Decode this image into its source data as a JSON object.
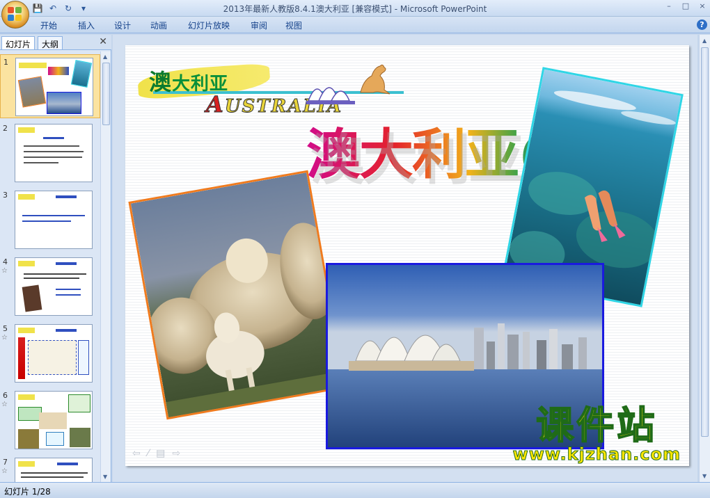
{
  "window": {
    "title": "2013年最新人教版8.4.1澳大利亚 [兼容模式] - Microsoft PowerPoint",
    "controls": [
      "–",
      "□",
      "×"
    ]
  },
  "qat": {
    "save": "💾",
    "undo": "↶",
    "redo": "↻",
    "customize": "▾"
  },
  "ribbon": {
    "tabs": [
      "开始",
      "插入",
      "设计",
      "动画",
      "幻灯片放映",
      "审阅",
      "视图"
    ],
    "help": "?"
  },
  "panel": {
    "tabs": [
      "幻灯片",
      "大纲"
    ],
    "close": "✕",
    "thumbnails": [
      {
        "num": "1",
        "star": ""
      },
      {
        "num": "2",
        "star": ""
      },
      {
        "num": "3",
        "star": ""
      },
      {
        "num": "4",
        "star": "☆"
      },
      {
        "num": "5",
        "star": "☆"
      },
      {
        "num": "6",
        "star": "☆"
      },
      {
        "num": "7",
        "star": "☆"
      }
    ]
  },
  "slide": {
    "banner_cn_first": "澳",
    "banner_cn_rest": "大利亚",
    "banner_en_first": "A",
    "banner_en_rest": "USTRALIA",
    "title": "澳大利亚(1)",
    "watermark_cn": "课件站",
    "watermark_url": "www.kjzhan.com"
  },
  "status": {
    "slide_counter": "幻灯片 1/28"
  }
}
